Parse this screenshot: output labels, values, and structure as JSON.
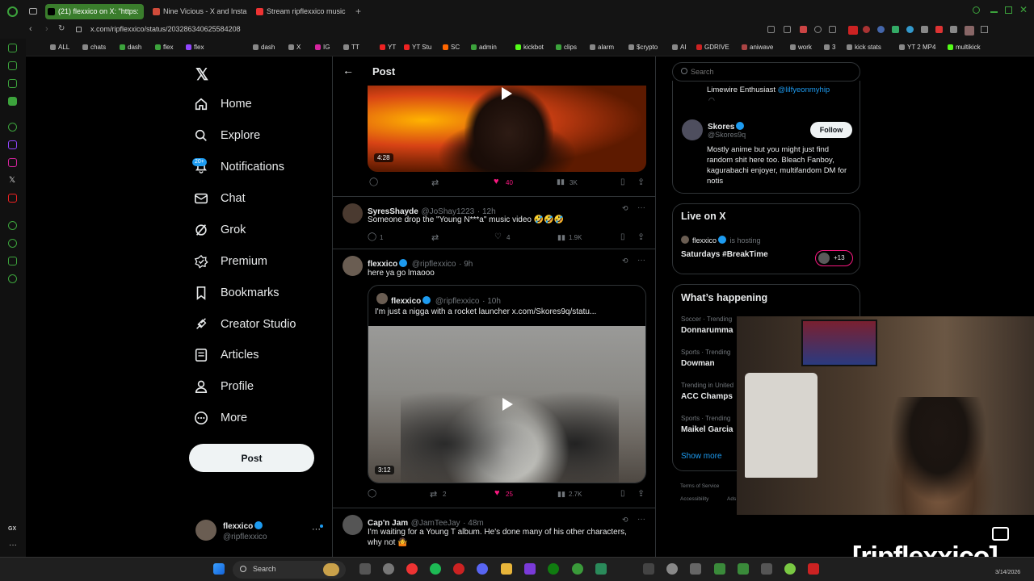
{
  "browser": {
    "tabs": [
      {
        "label": "(21) flexxico on X: \"https:",
        "active": true
      },
      {
        "label": "Nine Vicious - X and Insta",
        "active": false
      },
      {
        "label": "Stream ripflexxico music",
        "active": false
      }
    ],
    "url": "x.com/ripflexxico/status/2032863406255842​08",
    "bookmarks": [
      "ALL",
      "chats",
      "dash",
      "flex",
      "flex",
      "dash",
      "X",
      "IG",
      "TT",
      "YT",
      "YT Stu",
      "SC",
      "admin",
      "kickbot",
      "clips",
      "alarm",
      "$crypto",
      "AI",
      "GDRIVE",
      "aniwave",
      "work",
      "3",
      "kick stats",
      "YT 2 MP4",
      "multikick"
    ]
  },
  "nav": {
    "items": [
      "Home",
      "Explore",
      "Notifications",
      "Chat",
      "Grok",
      "Premium",
      "Bookmarks",
      "Creator Studio",
      "Articles",
      "Profile",
      "More"
    ],
    "notif_badge": "20+",
    "post_button": "Post",
    "account": {
      "name": "flexxico",
      "handle": "@ripflexxico"
    }
  },
  "header": {
    "title": "Post"
  },
  "video1": {
    "duration": "4:28",
    "likes": "40",
    "views": "3K"
  },
  "reply1": {
    "name": "SyresShayde",
    "handle": "@JoShay1223",
    "time": "· 12h",
    "text": "Someone drop the \"Young N***a\" music video 🤣🤣🤣",
    "replies": "1",
    "likes": "4",
    "views": "1.9K"
  },
  "reply2": {
    "name": "flexxico",
    "handle": "@ripflexxico",
    "time": "· 9h",
    "text": "here ya go lmaooo",
    "quote": {
      "name": "flexxico",
      "handle": "@ripflexxico",
      "time": "· 10h",
      "text": "I'm just a nigga with a rocket launcher  x.com/Skores9q/statu...",
      "duration": "3:12"
    },
    "retweets": "2",
    "likes": "25",
    "views": "2.7K"
  },
  "reply3": {
    "name": "Cap'n Jam",
    "handle": "@JamTeeJay",
    "time": "· 48m",
    "text": "I'm waiting for a Young T album. He's done many of his other characters, why not 🤷"
  },
  "sidebar": {
    "search_placeholder": "Search",
    "prev_follow": {
      "name": "Limewire Enthusiast",
      "handle": "@lilfyeonmyhip"
    },
    "follow": {
      "name": "Skores",
      "handle": "@Skores9q",
      "bio": "Mostly anime but you might just find random shit here too. Bleach Fanboy, kagurabachi enjoyer, multifandom DM for notis",
      "button": "Follow"
    },
    "live": {
      "title": "Live on X",
      "host": "flexxico",
      "host_note": "is hosting",
      "space": "Saturdays #BreakTime",
      "count": "+13"
    },
    "happening": {
      "title": "What’s happening",
      "trends": [
        {
          "context": "Soccer · Trending",
          "topic": "Donnarumma"
        },
        {
          "context": "Sports · Trending",
          "topic": "Dowman"
        },
        {
          "context": "Trending in United",
          "topic": "ACC Champs"
        },
        {
          "context": "Sports · Trending",
          "topic": "Maikel Garcia"
        }
      ],
      "show_more": "Show more"
    },
    "footer": [
      "Terms of Service",
      "Accessibility",
      "Ads"
    ]
  },
  "overlay": {
    "watermark": "[ripflexxico]"
  },
  "taskbar": {
    "search": "Search",
    "time": "3/14/2026"
  },
  "colors": {
    "accent": "#1d9bf0",
    "like": "#f91880",
    "bg": "#000000"
  }
}
